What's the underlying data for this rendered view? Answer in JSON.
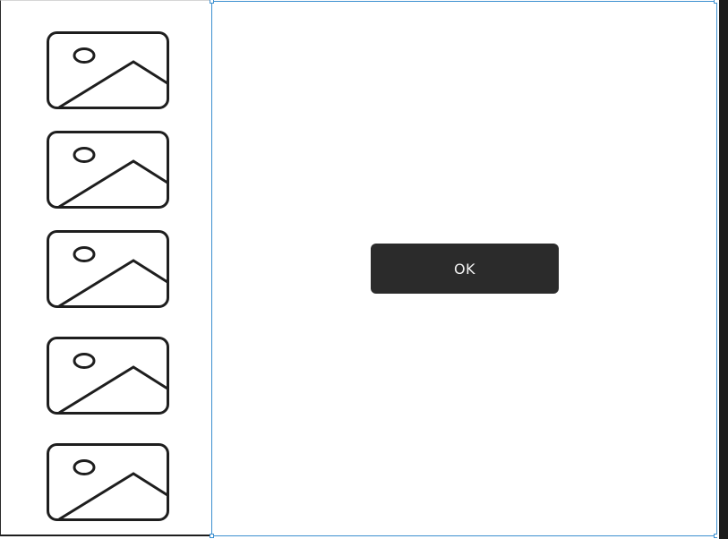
{
  "sidebar": {
    "thumbnails": [
      {
        "icon": "image-placeholder-icon"
      },
      {
        "icon": "image-placeholder-icon"
      },
      {
        "icon": "image-placeholder-icon"
      },
      {
        "icon": "image-placeholder-icon"
      },
      {
        "icon": "image-placeholder-icon"
      }
    ]
  },
  "dialog": {
    "ok_label": "OK"
  },
  "colors": {
    "button_bg": "#2b2b2b",
    "button_text": "#f2f2f2",
    "selection": "#3b8fd0",
    "icon_stroke": "#1e1e1e"
  }
}
